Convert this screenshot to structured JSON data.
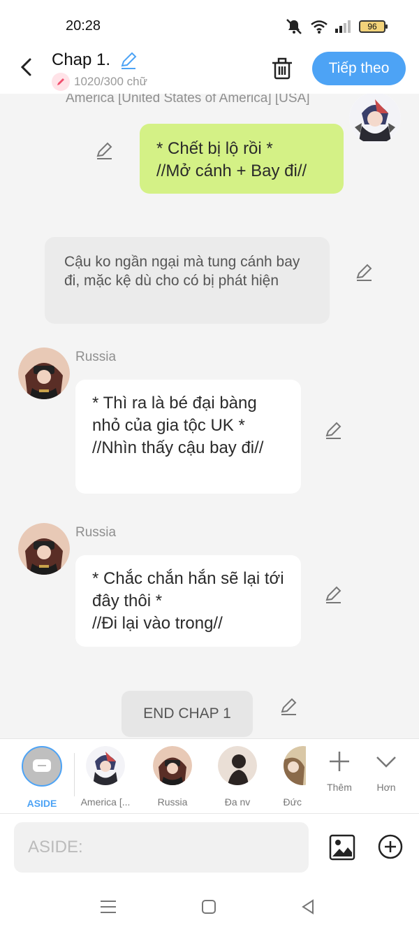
{
  "status": {
    "time": "20:28",
    "battery": "96"
  },
  "header": {
    "title": "Chap 1.",
    "word_count": "1020/300 chữ",
    "next_label": "Tiếp theo"
  },
  "chat": {
    "top_speaker": "America [United States of America] [USA]",
    "messages": [
      {
        "type": "self",
        "text": "* Chết bị lộ rồi *\n//Mở cánh + Bay đi//"
      },
      {
        "type": "narration",
        "text": "Cậu ko ngần ngại mà tung cánh bay đi, mặc kệ dù cho có bị phát hiện"
      },
      {
        "type": "other",
        "speaker": "Russia",
        "text": "* Thì ra là bé đại bàng nhỏ của gia tộc UK *\n//Nhìn thấy cậu bay đi//"
      },
      {
        "type": "other",
        "speaker": "Russia",
        "text": "* Chắc chắn hắn sẽ lại tới đây thôi *\n//Đi lại vào trong//"
      }
    ],
    "end_label": "END CHAP 1"
  },
  "characters": [
    {
      "label": "ASIDE",
      "active": true
    },
    {
      "label": "America [..."
    },
    {
      "label": "Russia"
    },
    {
      "label": "Đa nv"
    },
    {
      "label": "Đức"
    }
  ],
  "tools": {
    "more_label": "Thêm",
    "collapse_label": "Hơn"
  },
  "input": {
    "placeholder": "ASIDE:"
  },
  "colors": {
    "accent": "#4da3f5",
    "self_bubble": "#d4f186",
    "background": "#f4f4f4"
  }
}
